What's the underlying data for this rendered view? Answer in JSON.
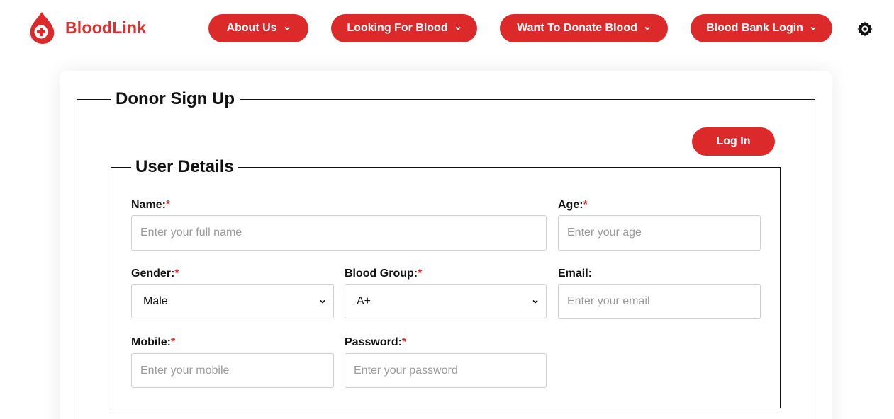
{
  "brand": {
    "name": "BloodLink",
    "accent": "#dc2a2a"
  },
  "nav": {
    "about": "About Us",
    "looking": "Looking For Blood",
    "donate": "Want To Donate Blood",
    "bank_login": "Blood Bank Login"
  },
  "form": {
    "title": "Donor Sign Up",
    "login_label": "Log In",
    "section_title": "User Details",
    "required_marker": "*",
    "fields": {
      "name": {
        "label": "Name:",
        "placeholder": "Enter your full name"
      },
      "age": {
        "label": "Age:",
        "placeholder": "Enter your age"
      },
      "gender": {
        "label": "Gender:",
        "value": "Male"
      },
      "blood_group": {
        "label": "Blood Group:",
        "value": "A+"
      },
      "email": {
        "label": "Email:",
        "placeholder": "Enter your email"
      },
      "mobile": {
        "label": "Mobile:",
        "placeholder": "Enter your mobile"
      },
      "password": {
        "label": "Password:",
        "placeholder": "Enter your password"
      }
    }
  },
  "icons": {
    "logo": "blood-drop-plus-icon",
    "theme": "gear-icon",
    "chevron": "chevron-down-icon"
  }
}
